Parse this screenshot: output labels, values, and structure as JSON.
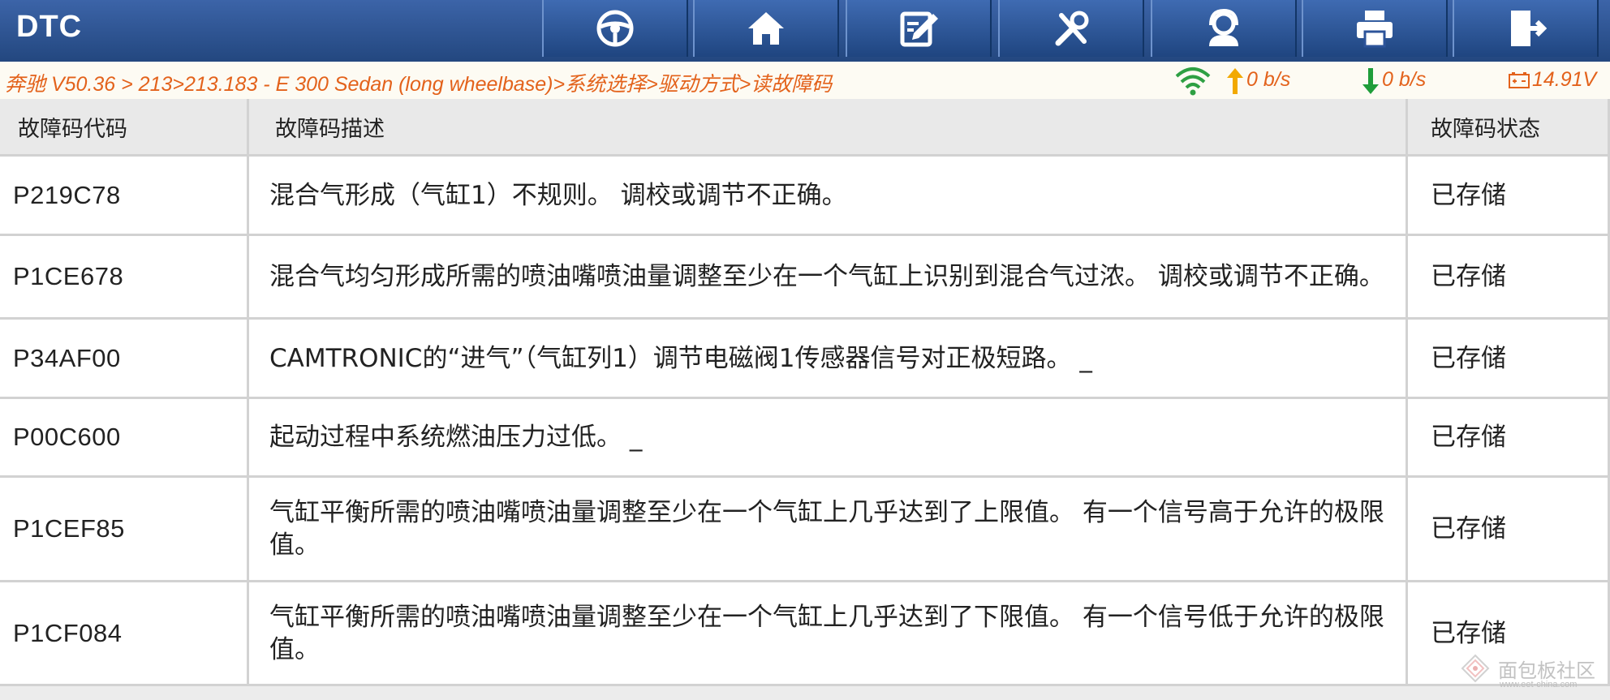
{
  "header": {
    "title": "DTC",
    "toolbar": [
      "steering-wheel",
      "home",
      "edit-report",
      "tools",
      "support",
      "print",
      "exit"
    ]
  },
  "status": {
    "breadcrumb": "奔驰 V50.36 > 213>213.183 - E 300 Sedan (long wheelbase)>系统选择>驱动方式>读故障码",
    "upload_rate": "0 b/s",
    "download_rate": "0 b/s",
    "battery_voltage": "14.91V"
  },
  "table": {
    "columns": [
      "故障码代码",
      "故障码描述",
      "故障码状态"
    ],
    "rows": [
      {
        "code": "P219C78",
        "description": "混合气形成（气缸1）不规则。 调校或调节不正确。",
        "status": "已存储"
      },
      {
        "code": "P1CE678",
        "description": "混合气均匀形成所需的喷油嘴喷油量调整至少在一个气缸上识别到混合气过浓。 调校或调节不正确。",
        "status": "已存储"
      },
      {
        "code": "P34AF00",
        "description": "CAMTRONIC的“进气”（气缸列1）调节电磁阀1传感器信号对正极短路。 _",
        "status": "已存储"
      },
      {
        "code": "P00C600",
        "description": "起动过程中系统燃油压力过低。 _",
        "status": "已存储"
      },
      {
        "code": "P1CEF85",
        "description": "气缸平衡所需的喷油嘴喷油量调整至少在一个气缸上几乎达到了上限值。 有一个信号高于允许的极限值。",
        "status": "已存储"
      },
      {
        "code": "P1CF084",
        "description": "气缸平衡所需的喷油嘴喷油量调整至少在一个气缸上几乎达到了下限值。 有一个信号低于允许的极限值。",
        "status": "已存储"
      }
    ]
  },
  "watermark": {
    "text": "面包板社区",
    "sub": "www.eet-china.com"
  },
  "colors": {
    "header_bg": "#2d549a",
    "breadcrumb_text": "#e3621b",
    "signal_green": "#2ea043",
    "upload_arrow": "#f2a900",
    "download_arrow": "#1f9d3a"
  }
}
